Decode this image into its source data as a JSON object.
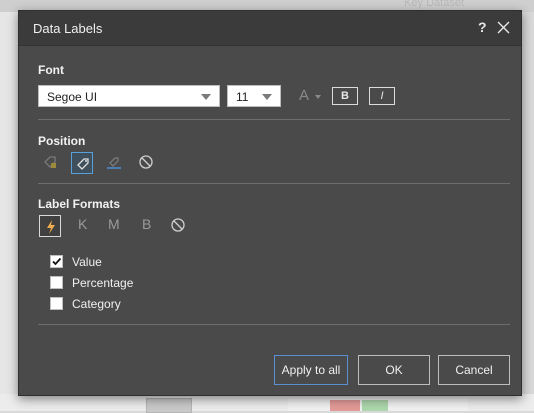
{
  "background": {
    "top_text": "Key Dataset"
  },
  "dialog": {
    "title": "Data Labels",
    "help_label": "?",
    "font": {
      "section_label": "Font",
      "family_value": "Segoe UI",
      "size_value": "11",
      "color_letter": "A",
      "bold_label": "B",
      "italic_label": "I"
    },
    "position": {
      "section_label": "Position",
      "options": [
        "inside-end",
        "outside-end",
        "inside-base",
        "none"
      ],
      "selected": "outside-end"
    },
    "label_formats": {
      "section_label": "Label Formats",
      "auto_icon": "lightning-icon",
      "thousands_label": "K",
      "millions_label": "M",
      "billions_label": "B",
      "selected": "auto",
      "checkboxes": [
        {
          "label": "Value",
          "checked": true
        },
        {
          "label": "Percentage",
          "checked": false
        },
        {
          "label": "Category",
          "checked": false
        }
      ]
    },
    "buttons": {
      "apply_all": "Apply to all",
      "ok": "OK",
      "cancel": "Cancel"
    }
  },
  "colors": {
    "dialog_bg": "#4a4a4a",
    "titlebar_bg": "#3b3b3b",
    "accent_blue": "#5a8fd2",
    "accent_gold": "#f0ad4e"
  }
}
